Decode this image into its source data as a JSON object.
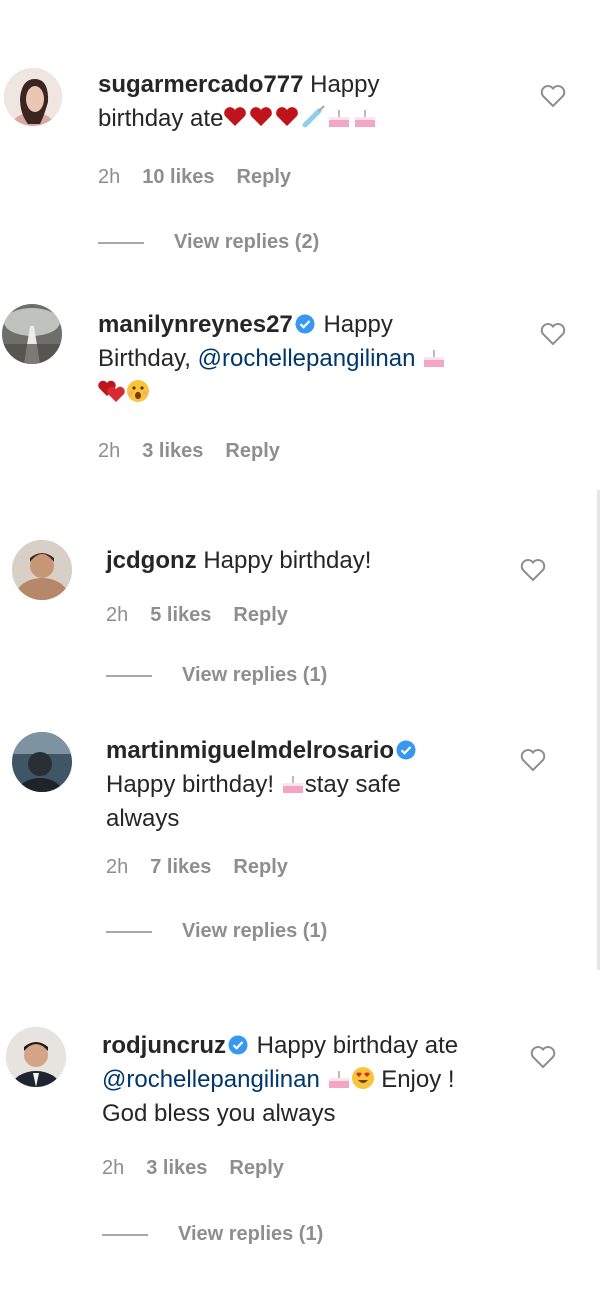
{
  "comments": [
    {
      "username": "sugarmercado777",
      "text_line1": "Happy",
      "text_line2": "birthday ate",
      "time": "2h",
      "likes": "10 likes",
      "reply": "Reply",
      "view_replies": "View replies (2)"
    },
    {
      "username": "manilynreynes27",
      "text_line1": "Happy",
      "text_line2": "Birthday,",
      "mention": "@rochellepangilinan",
      "time": "2h",
      "likes": "3 likes",
      "reply": "Reply"
    },
    {
      "username": "jcdgonz",
      "text_line1": "Happy birthday!",
      "time": "2h",
      "likes": "5 likes",
      "reply": "Reply",
      "view_replies": "View replies (1)"
    },
    {
      "username": "martinmiguelmdelrosario",
      "text_line1": "Happy birthday!",
      "text_line1b": "stay safe",
      "text_line2": "always",
      "time": "2h",
      "likes": "7 likes",
      "reply": "Reply",
      "view_replies": "View replies (1)"
    },
    {
      "username": "rodjuncruz",
      "text_line1": "Happy birthday ate",
      "mention": "@rochellepangilinan",
      "text_line2b": "Enjoy !",
      "text_line3": "God bless you always",
      "time": "2h",
      "likes": "3 likes",
      "reply": "Reply",
      "view_replies": "View replies (1)"
    }
  ],
  "icons": {
    "like": "heart-outline-icon",
    "verified": "verified-badge-icon"
  },
  "colors": {
    "text": "#262626",
    "meta": "#8e8e8e",
    "mention": "#00376b",
    "verified": "#3897f0",
    "emoji_heart": "#c0141c"
  }
}
